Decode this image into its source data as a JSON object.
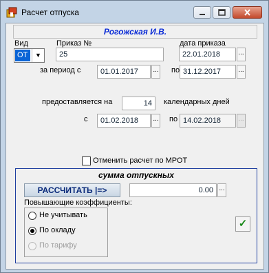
{
  "window": {
    "title": "Расчет отпуска",
    "app_icon": "app-icon",
    "controls": [
      "minimize-icon",
      "maximize-icon",
      "close-icon"
    ]
  },
  "employee": {
    "name": "Рогожская И.В."
  },
  "form": {
    "type_label": "Вид",
    "type_value": "ОТ",
    "order_label": "Приказ №",
    "order_value": "25",
    "order_date_label": "дата приказа",
    "order_date_value": "22.01.2018",
    "period_from_label": "за период с",
    "period_from_value": "01.01.2017",
    "period_to_label": "по",
    "period_to_value": "31.12.2017",
    "granted_label": "предоставляется на",
    "granted_days": "14",
    "days_unit": "календарных дней",
    "from_label": "с",
    "from_value": "01.02.2018",
    "to_label": "по",
    "to_value": "14.02.2018",
    "dots": "..."
  },
  "cancel_mrot": {
    "label": "Отменить расчет по МРОТ",
    "checked": false
  },
  "vacation_sum": {
    "title": "сумма отпускных",
    "calc_button": "РАССЧИТАТЬ |=>",
    "amount": "0.00",
    "coeff_label": "Повышающие коэффициенты:",
    "options": [
      {
        "label": "Не учитывать",
        "selected": false,
        "enabled": true
      },
      {
        "label": "По окладу",
        "selected": true,
        "enabled": true
      },
      {
        "label": "По тарифу",
        "selected": false,
        "enabled": false
      }
    ]
  },
  "ok_button": {
    "icon": "checkmark-icon",
    "glyph": "✓",
    "color": "#1a8a1a"
  }
}
